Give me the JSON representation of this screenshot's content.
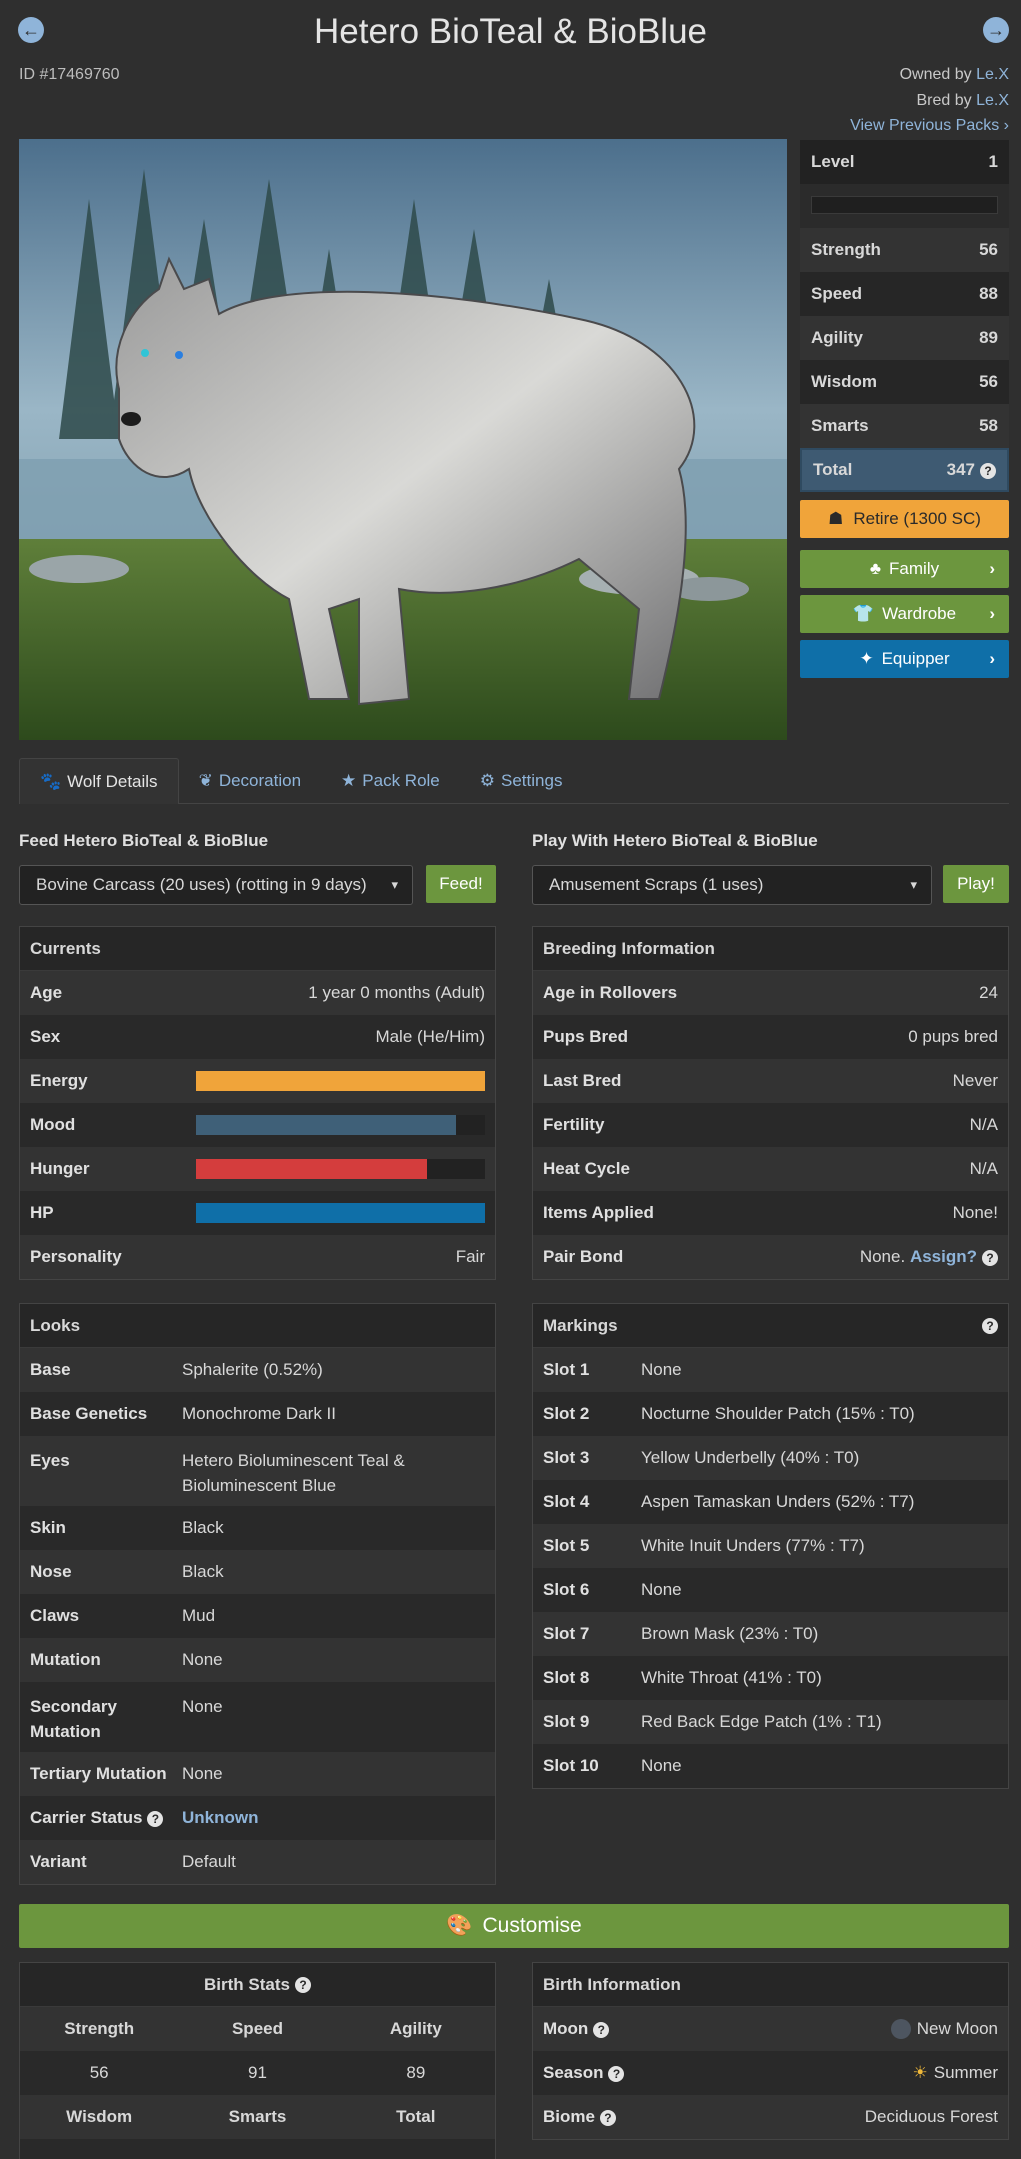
{
  "title": "Hetero BioTeal & BioBlue",
  "id_label": "ID #17469760",
  "owned_by_prefix": "Owned by",
  "owned_by": "Le.X",
  "bred_by_prefix": "Bred by",
  "bred_by": "Le.X",
  "view_previous": "View Previous Packs",
  "stats": {
    "level_label": "Level",
    "level": "1",
    "rows": [
      {
        "label": "Strength",
        "value": "56"
      },
      {
        "label": "Speed",
        "value": "88"
      },
      {
        "label": "Agility",
        "value": "89"
      },
      {
        "label": "Wisdom",
        "value": "56"
      },
      {
        "label": "Smarts",
        "value": "58"
      }
    ],
    "total_label": "Total",
    "total": "347"
  },
  "buttons": {
    "retire": "Retire (1300 SC)",
    "family": "Family",
    "wardrobe": "Wardrobe",
    "equipper": "Equipper",
    "feed": "Feed!",
    "play": "Play!",
    "customise": "Customise",
    "assign": "Assign?"
  },
  "tabs": [
    "Wolf Details",
    "Decoration",
    "Pack Role",
    "Settings"
  ],
  "feed": {
    "label": "Feed Hetero BioTeal & BioBlue",
    "selected": "Bovine Carcass (20 uses) (rotting in 9 days)"
  },
  "play": {
    "label": "Play With Hetero BioTeal & BioBlue",
    "selected": "Amusement Scraps (1 uses)"
  },
  "currents": {
    "title": "Currents",
    "age_label": "Age",
    "age": "1 year 0 months (Adult)",
    "sex_label": "Sex",
    "sex": "Male (He/Him)",
    "energy_label": "Energy",
    "energy": 1.0,
    "mood_label": "Mood",
    "mood": 0.9,
    "hunger_label": "Hunger",
    "hunger": 0.8,
    "hp_label": "HP",
    "hp": 1.0,
    "personality_label": "Personality",
    "personality": "Fair",
    "colors": {
      "energy": "#f0a43a",
      "mood": "#3f6078",
      "hunger": "#d43d3d",
      "hp": "#0f6fa8"
    }
  },
  "breeding": {
    "title": "Breeding Information",
    "rows": [
      {
        "label": "Age in Rollovers",
        "value": "24"
      },
      {
        "label": "Pups Bred",
        "value": "0 pups bred"
      },
      {
        "label": "Last Bred",
        "value": "Never"
      },
      {
        "label": "Fertility",
        "value": "N/A"
      },
      {
        "label": "Heat Cycle",
        "value": "N/A"
      },
      {
        "label": "Items Applied",
        "value": "None!"
      }
    ],
    "pair_bond_label": "Pair Bond",
    "pair_bond": "None."
  },
  "looks": {
    "title": "Looks",
    "rows": [
      {
        "label": "Base",
        "value": "Sphalerite (0.52%)"
      },
      {
        "label": "Base Genetics",
        "value": "Monochrome Dark II"
      },
      {
        "label": "Eyes",
        "value": "Hetero Bioluminescent Teal & Bioluminescent Blue"
      },
      {
        "label": "Skin",
        "value": "Black"
      },
      {
        "label": "Nose",
        "value": "Black"
      },
      {
        "label": "Claws",
        "value": "Mud"
      },
      {
        "label": "Mutation",
        "value": "None"
      },
      {
        "label": "Secondary Mutation",
        "value": "None"
      },
      {
        "label": "Tertiary Mutation",
        "value": "None"
      }
    ],
    "carrier_label": "Carrier Status",
    "carrier": "Unknown",
    "variant_label": "Variant",
    "variant": "Default"
  },
  "markings": {
    "title": "Markings",
    "rows": [
      {
        "label": "Slot 1",
        "value": "None"
      },
      {
        "label": "Slot 2",
        "value": "Nocturne Shoulder Patch (15% : T0)"
      },
      {
        "label": "Slot 3",
        "value": "Yellow Underbelly (40% : T0)"
      },
      {
        "label": "Slot 4",
        "value": "Aspen Tamaskan Unders (52% : T7)"
      },
      {
        "label": "Slot 5",
        "value": "White Inuit Unders (77% : T7)"
      },
      {
        "label": "Slot 6",
        "value": "None"
      },
      {
        "label": "Slot 7",
        "value": "Brown Mask (23% : T0)"
      },
      {
        "label": "Slot 8",
        "value": "White Throat (41% : T0)"
      },
      {
        "label": "Slot 9",
        "value": "Red Back Edge Patch (1% : T1)"
      },
      {
        "label": "Slot 10",
        "value": "None"
      }
    ]
  },
  "birth_stats": {
    "title": "Birth Stats",
    "h1": [
      "Strength",
      "Speed",
      "Agility"
    ],
    "v1": [
      "56",
      "91",
      "89"
    ],
    "h2": [
      "Wisdom",
      "Smarts",
      "Total"
    ]
  },
  "birth_info": {
    "title": "Birth Information",
    "moon_label": "Moon",
    "moon": "New Moon",
    "season_label": "Season",
    "season": "Summer",
    "biome_label": "Biome",
    "biome": "Deciduous Forest"
  }
}
